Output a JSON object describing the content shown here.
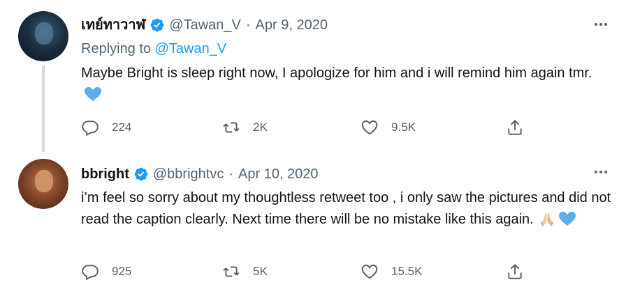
{
  "tweets": [
    {
      "display_name": "เทย์ทาวาฬ",
      "handle": "@Tawan_V",
      "separator": "·",
      "date": "Apr 9, 2020",
      "replying_prefix": "Replying to",
      "replying_to": "@Tawan_V",
      "text": "Maybe Bright is sleep right now, I apologize for him and i will remind him again tmr.",
      "emoji": [
        "blue-heart"
      ],
      "stats": {
        "replies": "224",
        "retweets": "2K",
        "likes": "9.5K"
      }
    },
    {
      "display_name": "bbright",
      "handle": "@bbrightvc",
      "separator": "·",
      "date": "Apr 10, 2020",
      "text": "i’m feel so sorry about my thoughtless retweet too , i only saw the pictures and did not read the caption clearly. Next time there will be no mistake like this again.",
      "emoji": [
        "folded-hands",
        "blue-heart"
      ],
      "stats": {
        "replies": "925",
        "retweets": "5K",
        "likes": "15.5K"
      }
    }
  ],
  "icons": {
    "verified": "verified-badge-icon",
    "more": "more-options-icon",
    "reply": "reply-icon",
    "retweet": "retweet-icon",
    "like": "like-heart-icon",
    "share": "share-icon"
  },
  "colors": {
    "text": "#0f1419",
    "secondary": "#536471",
    "link": "#1d9bf0",
    "thread_line": "#cfd9de",
    "heart_emoji": "#5dadec"
  }
}
